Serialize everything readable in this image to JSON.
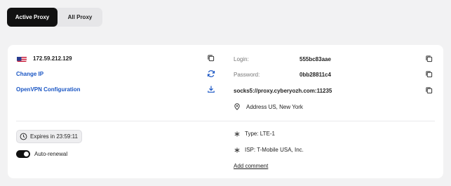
{
  "tabs": {
    "active": "Active Proxy",
    "inactive": "All Proxy"
  },
  "proxy": {
    "ip": "172.59.212.129",
    "change_ip": "Change IP",
    "openvpn": "OpenVPN Configuration",
    "login_label": "Login:",
    "login_value": "555bc83aae",
    "password_label": "Password:",
    "password_value": "0bb28811c4",
    "socks": "socks5://proxy.cyberyozh.com:11235",
    "address": "Address US, New York",
    "expires": "Expires in 23:59:11",
    "auto_renewal": "Auto-renewal",
    "type": "Type: LTE-1",
    "isp": "ISP: T-Mobile USA, Inc.",
    "add_comment": "Add comment"
  },
  "colors": {
    "accent": "#1a56c4",
    "dark": "#111111",
    "background": "#f2f2f3"
  },
  "icons": [
    "us-flag-icon",
    "copy-icon",
    "refresh-icon",
    "download-icon",
    "location-pin-icon",
    "clock-icon",
    "asterisk-icon"
  ]
}
